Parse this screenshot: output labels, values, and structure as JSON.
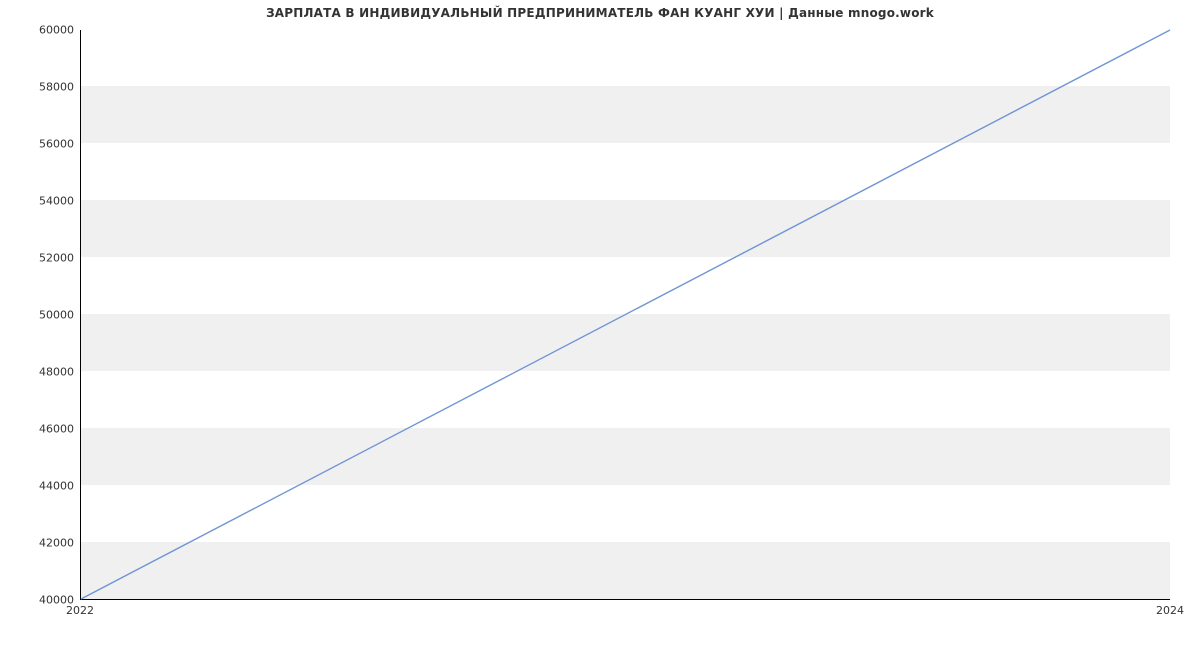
{
  "chart_data": {
    "type": "line",
    "title": "ЗАРПЛАТА В ИНДИВИДУАЛЬНЫЙ ПРЕДПРИНИМАТЕЛЬ ФАН КУАНГ ХУИ | Данные mnogo.work",
    "xlabel": "",
    "ylabel": "",
    "x": [
      2022,
      2024
    ],
    "values": [
      40000,
      60000
    ],
    "y_ticks": [
      40000,
      42000,
      44000,
      46000,
      48000,
      50000,
      52000,
      54000,
      56000,
      58000,
      60000
    ],
    "x_ticks": [
      2022,
      2024
    ],
    "xlim": [
      2022,
      2024
    ],
    "ylim": [
      40000,
      60000
    ],
    "line_color": "#6f95d6",
    "grid": "horizontal-bands"
  }
}
